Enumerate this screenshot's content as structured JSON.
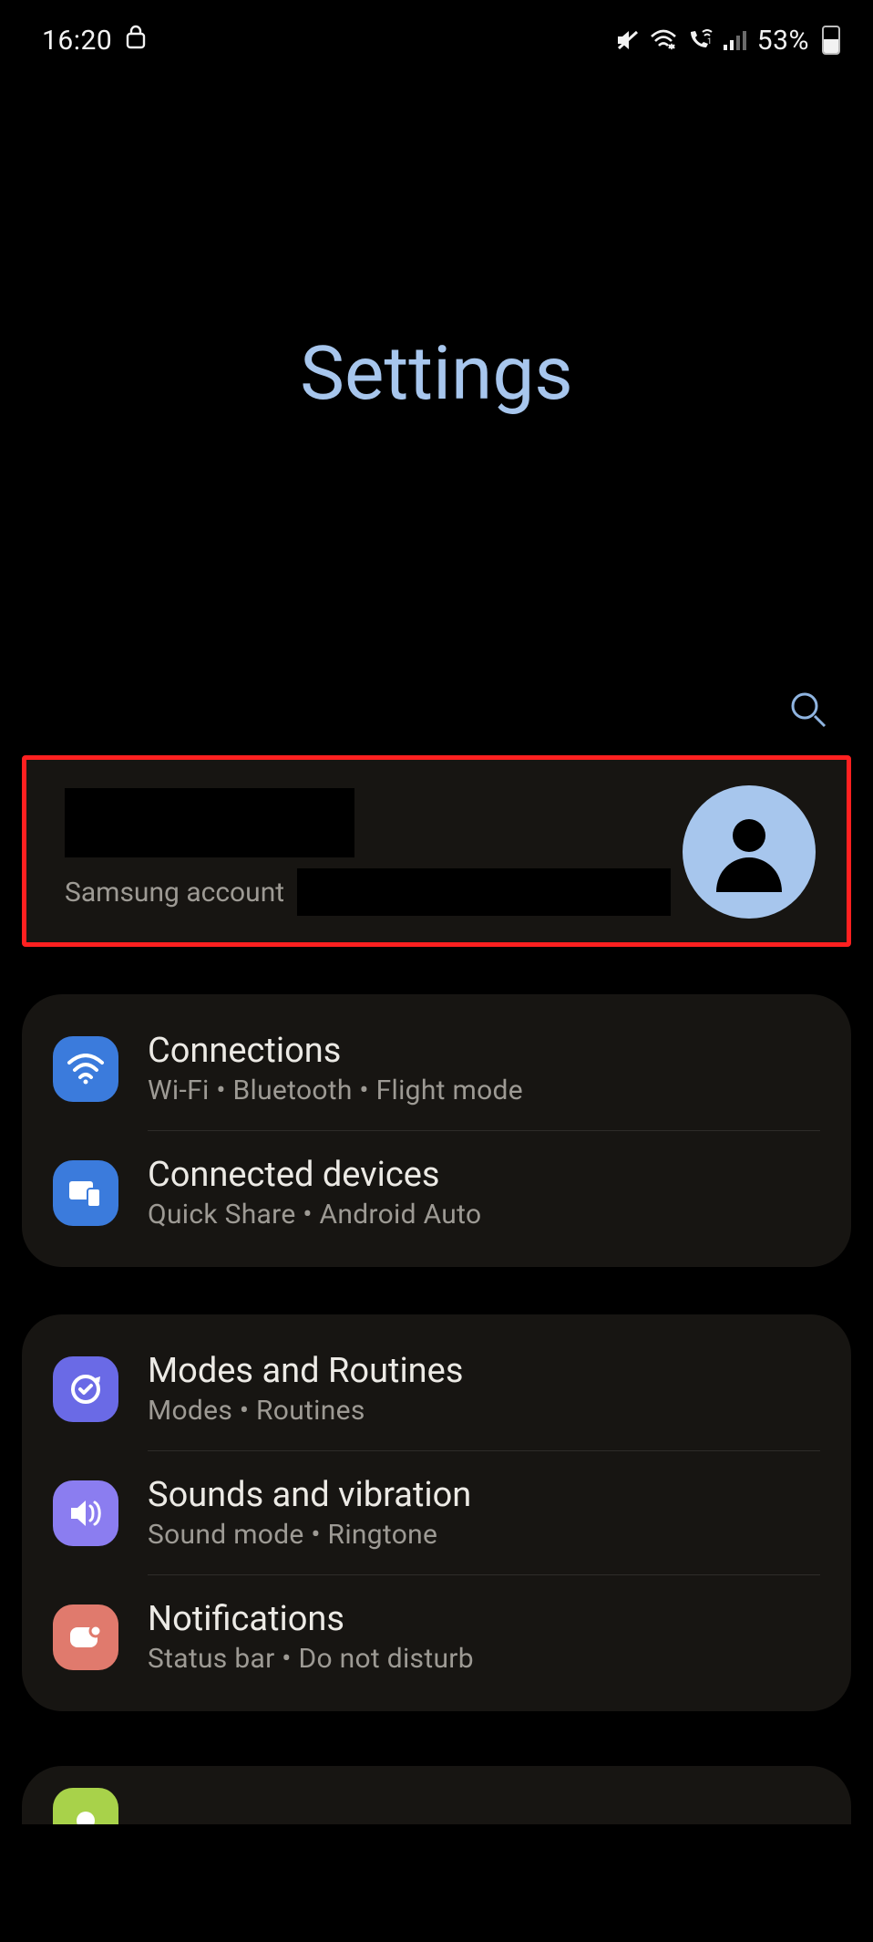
{
  "statusbar": {
    "time": "16:20",
    "battery_pct": "53%",
    "battery_level": 0.53
  },
  "hero": {
    "title": "Settings"
  },
  "account": {
    "subtitle": "Samsung account"
  },
  "groups": [
    {
      "items": [
        {
          "id": "connections",
          "title": "Connections",
          "sub": "Wi-Fi  •  Bluetooth  •  Flight mode",
          "icon": "wifi",
          "color": "ic-blue"
        },
        {
          "id": "connected-devices",
          "title": "Connected devices",
          "sub": "Quick Share  •  Android Auto",
          "icon": "devices",
          "color": "ic-blue2"
        }
      ]
    },
    {
      "items": [
        {
          "id": "modes-routines",
          "title": "Modes and Routines",
          "sub": "Modes  •  Routines",
          "icon": "routine",
          "color": "ic-indigo"
        },
        {
          "id": "sounds",
          "title": "Sounds and vibration",
          "sub": "Sound mode  •  Ringtone",
          "icon": "sound",
          "color": "ic-violet"
        },
        {
          "id": "notifications",
          "title": "Notifications",
          "sub": "Status bar  •  Do not disturb",
          "icon": "notif",
          "color": "ic-coral"
        }
      ]
    }
  ]
}
